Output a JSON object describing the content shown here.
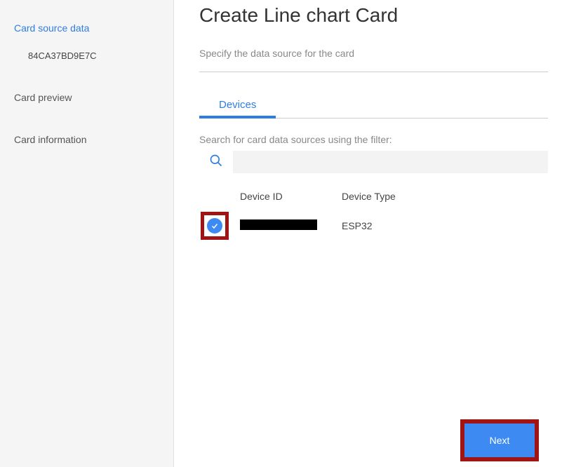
{
  "sidebar": {
    "items": [
      {
        "label": "Card source data",
        "active": true
      },
      {
        "label": "Card preview",
        "active": false
      },
      {
        "label": "Card information",
        "active": false
      }
    ],
    "subitem": "84CA37BD9E7C"
  },
  "main": {
    "title": "Create Line chart Card",
    "subtitle": "Specify the data source for the card",
    "tabs": [
      {
        "label": "Devices",
        "active": true
      }
    ],
    "filter_label": "Search for card data sources using the filter:",
    "search_placeholder": "",
    "table": {
      "headers": {
        "device_id": "Device ID",
        "device_type": "Device Type"
      },
      "rows": [
        {
          "checked": true,
          "device_id": "",
          "device_type": "ESP32"
        }
      ]
    },
    "next_label": "Next"
  }
}
